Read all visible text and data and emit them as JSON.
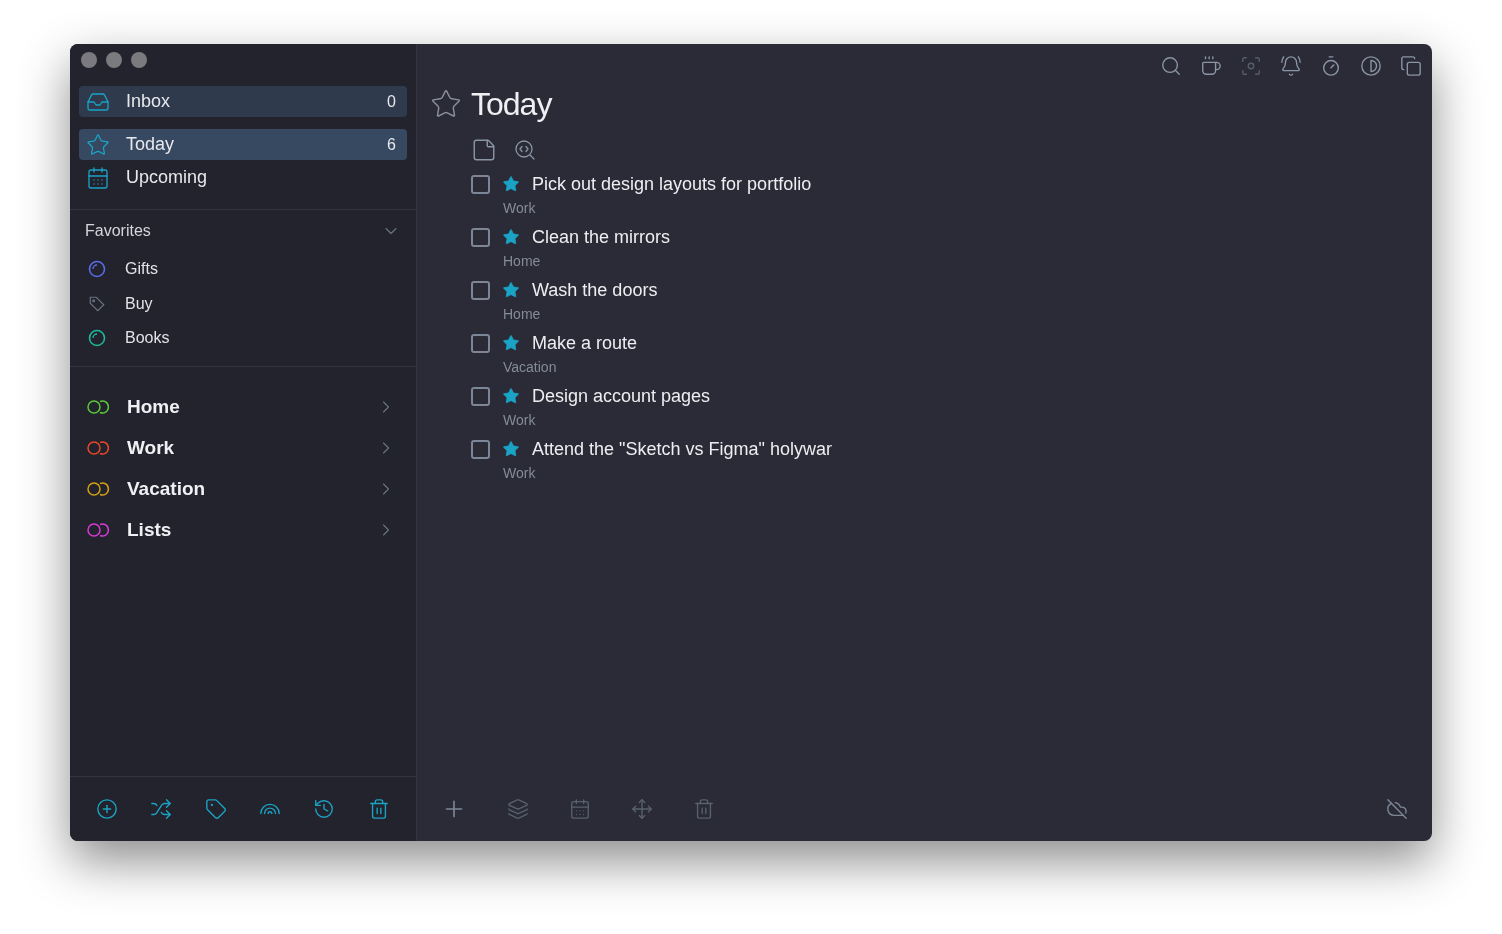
{
  "nav": [
    {
      "label": "Inbox",
      "count": "0",
      "selected": false,
      "focused": true
    },
    {
      "label": "Today",
      "count": "6",
      "selected": true,
      "focused": false
    },
    {
      "label": "Upcoming",
      "selected": false,
      "focused": false
    }
  ],
  "favorites": {
    "title": "Favorites",
    "expanded": true,
    "items": [
      {
        "label": "Gifts",
        "kind": "ring",
        "color": "#5a6be8"
      },
      {
        "label": "Buy",
        "kind": "tag",
        "color": "#6b7280"
      },
      {
        "label": "Books",
        "kind": "ring",
        "color": "#1fb89a"
      }
    ]
  },
  "projects": [
    {
      "label": "Home",
      "color": "#5cc73a"
    },
    {
      "label": "Work",
      "color": "#e8472a"
    },
    {
      "label": "Vacation",
      "color": "#d4a017"
    },
    {
      "label": "Lists",
      "color": "#d63ad6"
    }
  ],
  "main": {
    "title": "Today"
  },
  "tasks": [
    {
      "title": "Pick out design layouts for portfolio",
      "project": "Work",
      "checked": false,
      "starred": true
    },
    {
      "title": "Clean the mirrors",
      "project": "Home",
      "checked": false,
      "starred": true
    },
    {
      "title": "Wash the doors",
      "project": "Home",
      "checked": false,
      "starred": true
    },
    {
      "title": "Make a route",
      "project": "Vacation",
      "checked": false,
      "starred": true
    },
    {
      "title": "Design account pages",
      "project": "Work",
      "checked": false,
      "starred": true
    },
    {
      "title": "Attend the \"Sketch vs Figma\" holywar",
      "project": "Work",
      "checked": false,
      "starred": true
    }
  ]
}
